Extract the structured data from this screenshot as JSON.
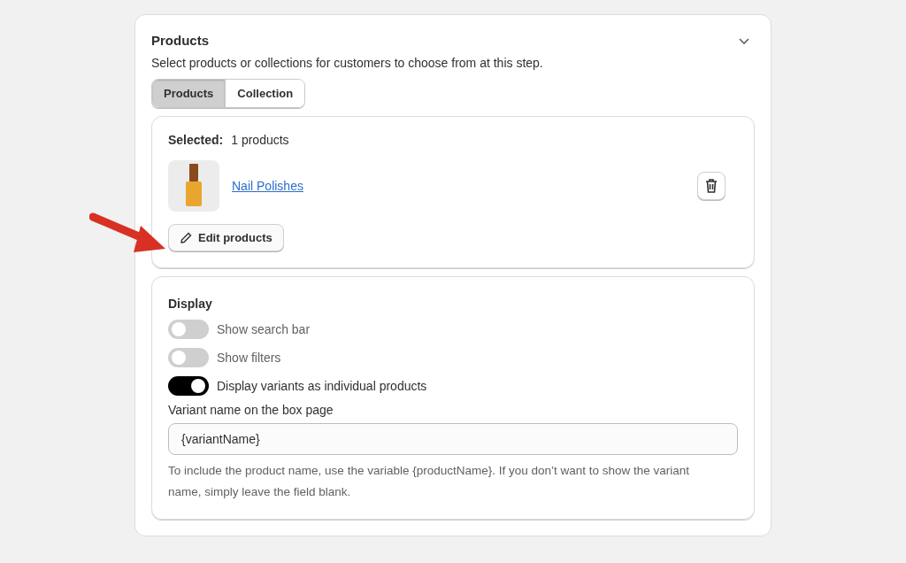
{
  "section": {
    "title": "Products",
    "description": "Select products or collections for customers to choose from at this step.",
    "expanded": true
  },
  "tabs": [
    {
      "label": "Products",
      "selected": true
    },
    {
      "label": "Collection",
      "selected": false
    }
  ],
  "selection": {
    "label": "Selected:",
    "count": "1 products",
    "products": [
      {
        "name": "Nail Polishes"
      }
    ],
    "edit_button": "Edit products"
  },
  "display": {
    "title": "Display",
    "toggles": [
      {
        "label": "Show search bar",
        "on": false
      },
      {
        "label": "Show filters",
        "on": false
      },
      {
        "label": "Display variants as individual products",
        "on": true
      }
    ],
    "field_label": "Variant name on the box page",
    "field_value": "{variantName}",
    "help": "To include the product name, use the variable {productName}. If you don’t want to show the variant name, simply leave the field blank."
  }
}
